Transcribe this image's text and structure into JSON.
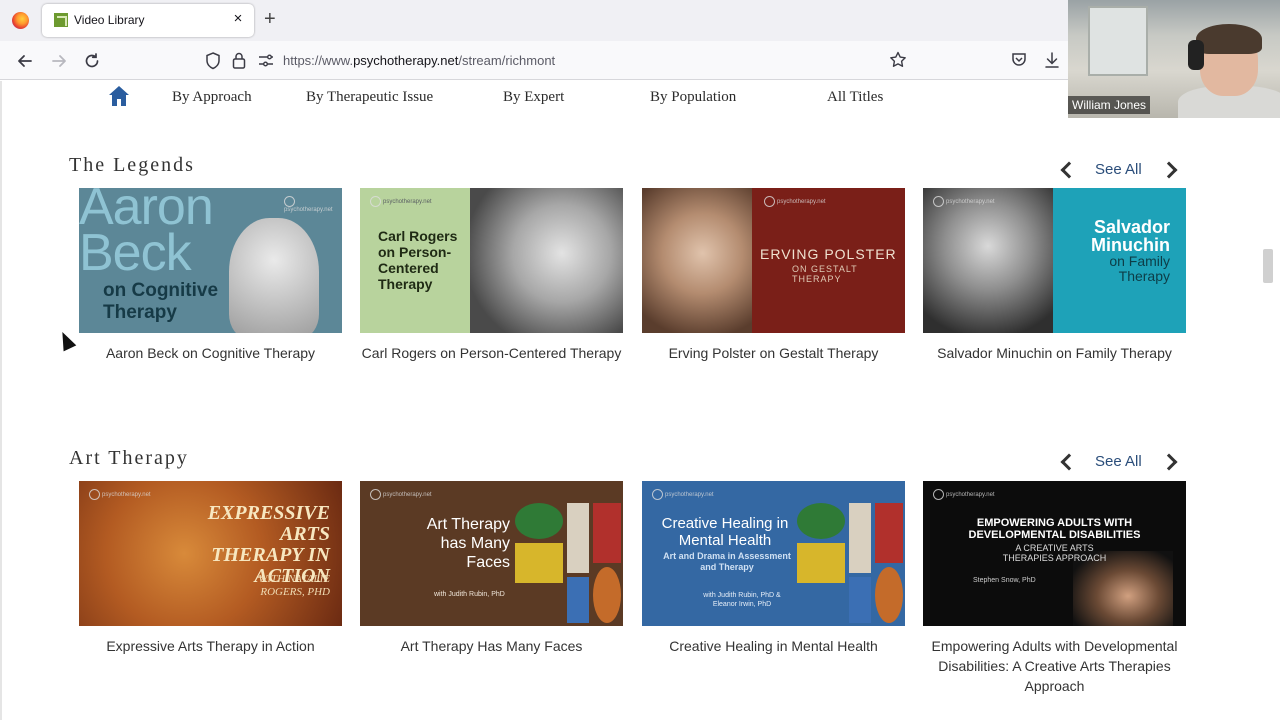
{
  "browser": {
    "tab_title": "Video Library",
    "tab_close": "×",
    "new_tab": "+",
    "url_prefix": "https://www.",
    "url_domain": "psychotherapy.net",
    "url_path": "/stream/richmont",
    "icons": [
      "back-icon",
      "forward-icon",
      "reload-icon",
      "shield-icon",
      "lock-icon",
      "permissions-icon",
      "star-icon",
      "pocket-icon",
      "download-icon"
    ]
  },
  "webcam": {
    "name": "William Jones"
  },
  "nav": {
    "items": [
      "By Approach",
      "By Therapeutic Issue",
      "By Expert",
      "By Population",
      "All Titles"
    ],
    "home_color": "#2a5d9f"
  },
  "sections": [
    {
      "title": "The Legends",
      "see_all": "See All",
      "cards": [
        {
          "caption": "Aaron Beck on Cognitive Therapy",
          "art": {
            "big": "Aaron Beck",
            "on": "on Cognitive Therapy"
          }
        },
        {
          "caption": "Carl Rogers on Person-Centered Therapy",
          "art": {
            "txt": "Carl Rogers on Person-Centered Therapy"
          }
        },
        {
          "caption": "Erving Polster on Gestalt Therapy",
          "art": {
            "txt": "ERVING POLSTER",
            "sub": "ON GESTALT THERAPY"
          }
        },
        {
          "caption": "Salvador Minuchin on Family Therapy",
          "art": {
            "txt": "Salvador Minuchin",
            "sub": "on Family Therapy"
          }
        }
      ]
    },
    {
      "title": "Art Therapy",
      "see_all": "See All",
      "cards": [
        {
          "caption": "Expressive Arts Therapy in Action",
          "art": {
            "txt": "EXPRESSIVE ARTS THERAPY IN ACTION",
            "sub": "WITH NATALIE ROGERS, PHD"
          }
        },
        {
          "caption": "Art Therapy Has Many Faces",
          "art": {
            "txt": "Art Therapy has Many Faces",
            "sub": "with Judith Rubin, PhD"
          }
        },
        {
          "caption": "Creative Healing in Mental Health",
          "art": {
            "txt": "Creative Healing in Mental Health",
            "sub": "Art and Drama in Assessment and Therapy",
            "sub2": "with Judith Rubin, PhD & Eleanor Irwin, PhD"
          }
        },
        {
          "caption": "Empowering Adults with Developmental Disabilities: A Creative Arts Therapies Approach",
          "art": {
            "txt": "EMPOWERING ADULTS WITH DEVELOPMENTAL DISABILITIES",
            "sub": "A CREATIVE ARTS THERAPIES APPROACH",
            "sub2": "Stephen Snow, PhD"
          }
        }
      ]
    }
  ],
  "thumb_logo": "psychotherapy.net"
}
